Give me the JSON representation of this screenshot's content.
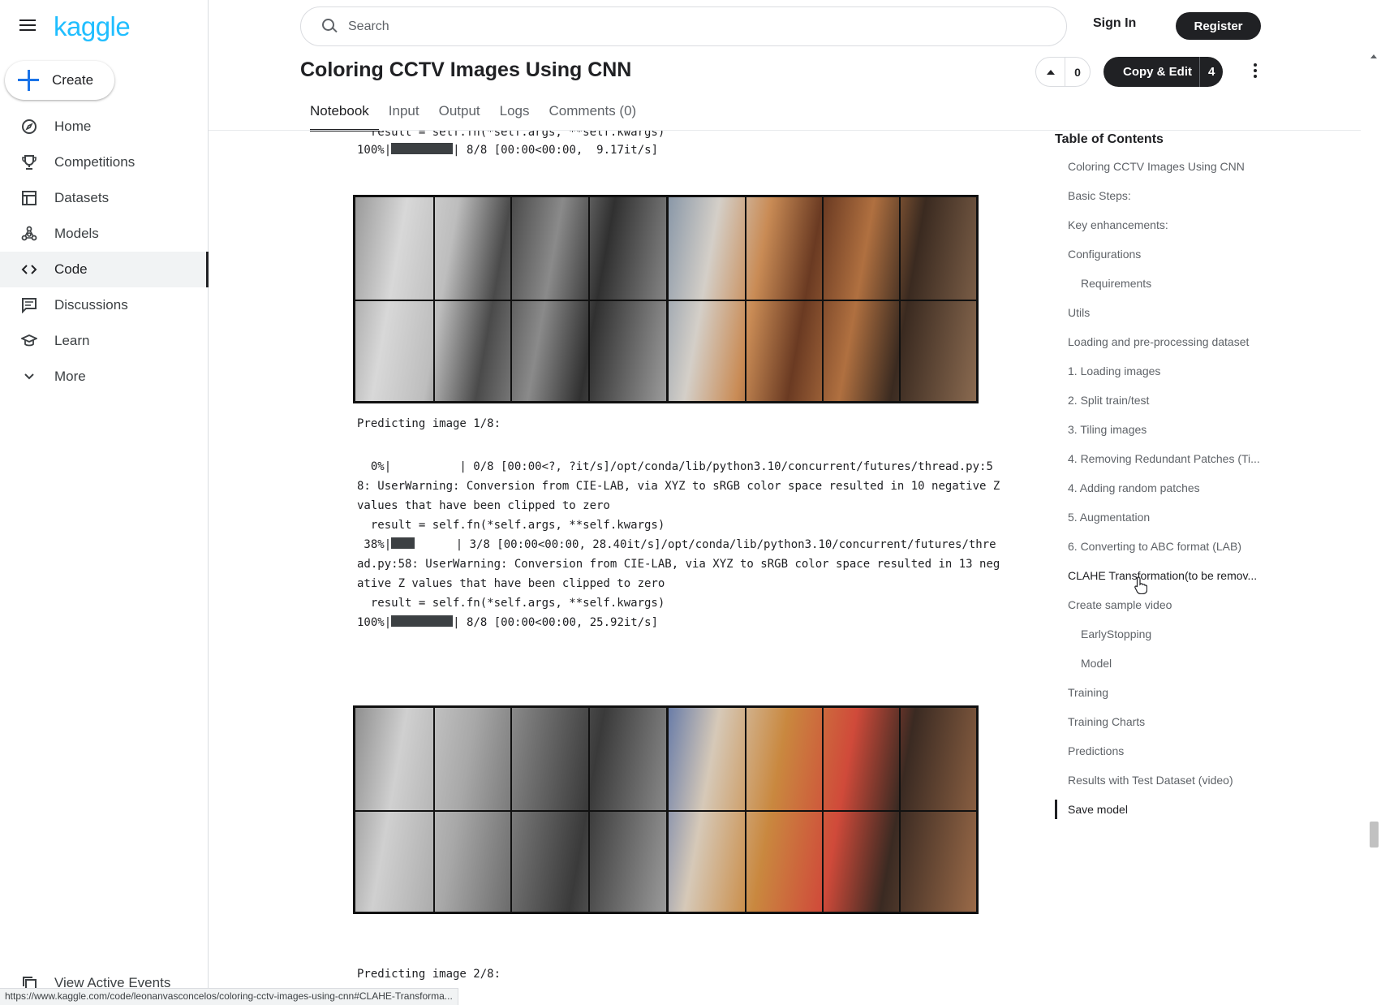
{
  "app": {
    "logo": "kaggle"
  },
  "sidebar": {
    "create_label": "Create",
    "items": [
      {
        "label": "Home",
        "icon": "compass-icon"
      },
      {
        "label": "Competitions",
        "icon": "trophy-icon"
      },
      {
        "label": "Datasets",
        "icon": "table-icon"
      },
      {
        "label": "Models",
        "icon": "models-icon"
      },
      {
        "label": "Code",
        "icon": "code-icon",
        "active": true
      },
      {
        "label": "Discussions",
        "icon": "discussion-icon"
      },
      {
        "label": "Learn",
        "icon": "graduation-cap-icon"
      },
      {
        "label": "More",
        "icon": "chevron-down-icon"
      }
    ],
    "view_events": "View Active Events"
  },
  "header": {
    "search_placeholder": "Search",
    "sign_in": "Sign In",
    "register": "Register"
  },
  "notebook": {
    "title": "Coloring CCTV Images Using CNN",
    "vote_count": "0",
    "copy_edit_label": "Copy & Edit",
    "copy_edit_count": "4",
    "tabs": [
      "Notebook",
      "Input",
      "Output",
      "Logs",
      "Comments (0)"
    ],
    "active_tab": "Notebook"
  },
  "output": {
    "top_line1": "  result = self.fn(*self.args, **self.kwargs)",
    "top_line2_prefix": "100%|",
    "top_line2_suffix": "| 8/8 [00:00<00:00,  9.17it/s]",
    "predict1": "Predicting image 1/8:",
    "log1_line1": "  0%|          | 0/8 [00:00<?, ?it/s]/opt/conda/lib/python3.10/concurrent/futures/thread.py:5",
    "log1_line2": "8: UserWarning: Conversion from CIE-LAB, via XYZ to sRGB color space resulted in 10 negative Z",
    "log1_line3": "values that have been clipped to zero",
    "log1_line4": "  result = self.fn(*self.args, **self.kwargs)",
    "log1_line5_prefix": " 38%|",
    "log1_line5_suffix": "      | 3/8 [00:00<00:00, 28.40it/s]/opt/conda/lib/python3.10/concurrent/futures/thre",
    "log1_line6": "ad.py:58: UserWarning: Conversion from CIE-LAB, via XYZ to sRGB color space resulted in 13 neg",
    "log1_line7": "ative Z values that have been clipped to zero",
    "log1_line8": "  result = self.fn(*self.args, **self.kwargs)",
    "log1_line9_prefix": "100%|",
    "log1_line9_suffix": "| 8/8 [00:00<00:00, 25.92it/s]",
    "predict2": "Predicting image 2/8:"
  },
  "toc": {
    "title": "Table of Contents",
    "items": [
      {
        "label": "Coloring CCTV Images Using CNN",
        "sub": false
      },
      {
        "label": "Basic Steps:",
        "sub": false
      },
      {
        "label": "Key enhancements:",
        "sub": false
      },
      {
        "label": "Configurations",
        "sub": false
      },
      {
        "label": "Requirements",
        "sub": true
      },
      {
        "label": "Utils",
        "sub": false
      },
      {
        "label": "Loading and pre-processing dataset",
        "sub": false
      },
      {
        "label": "1. Loading images",
        "sub": false
      },
      {
        "label": "2. Split train/test",
        "sub": false
      },
      {
        "label": "3. Tiling images",
        "sub": false
      },
      {
        "label": "4. Removing Redundant Patches (Ti...",
        "sub": false
      },
      {
        "label": "4. Adding random patches",
        "sub": false
      },
      {
        "label": "5. Augmentation",
        "sub": false
      },
      {
        "label": "6. Converting to ABC format (LAB)",
        "sub": false
      },
      {
        "label": "CLAHE Transformation(to be remov...",
        "sub": false,
        "hover": true
      },
      {
        "label": "Create sample video",
        "sub": false
      },
      {
        "label": "EarlyStopping",
        "sub": true
      },
      {
        "label": "Model",
        "sub": true
      },
      {
        "label": "Training",
        "sub": false
      },
      {
        "label": "Training Charts",
        "sub": false
      },
      {
        "label": "Predictions",
        "sub": false
      },
      {
        "label": "Results with Test Dataset (video)",
        "sub": false
      },
      {
        "label": "Save model",
        "sub": false,
        "current": true
      }
    ]
  },
  "status_bar": {
    "url": "https://www.kaggle.com/code/leonanvasconcelos/coloring-cctv-images-using-cnn#CLAHE-Transforma..."
  },
  "progress": {
    "first_bar": 100,
    "second_bar": 38,
    "third_bar": 100
  }
}
